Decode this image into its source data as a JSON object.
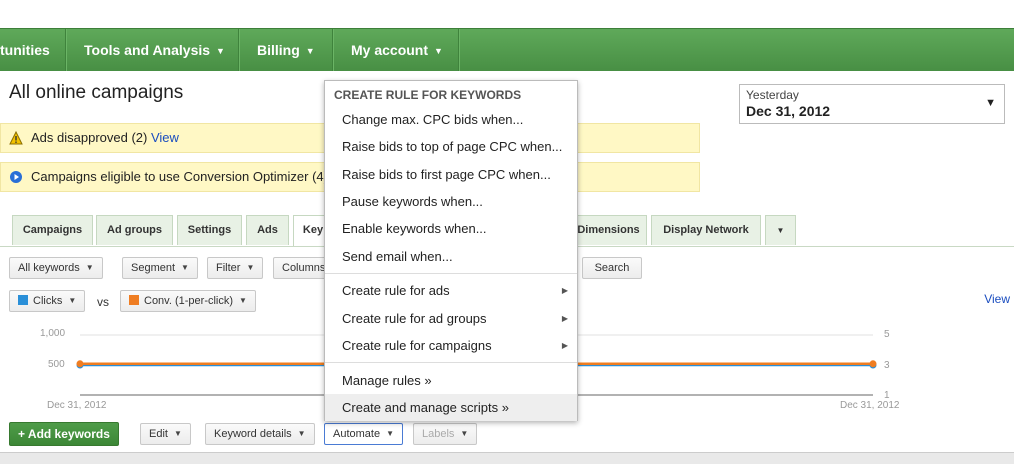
{
  "nav": {
    "items": [
      {
        "label": "tunities",
        "caret": ""
      },
      {
        "label": "Tools and Analysis",
        "caret": "▼"
      },
      {
        "label": "Billing",
        "caret": "▼"
      },
      {
        "label": "My account",
        "caret": "▼"
      }
    ]
  },
  "page": {
    "title": "All online campaigns"
  },
  "date_range": {
    "label": "Yesterday",
    "value": "Dec 31, 2012"
  },
  "alerts": [
    {
      "text": "Ads disapproved (2)",
      "link": "View",
      "icon": "warning-icon"
    },
    {
      "text": "Campaigns eligible to use Conversion Optimizer (4)",
      "icon": "info-icon"
    }
  ],
  "tabs": [
    "Campaigns",
    "Ad groups",
    "Settings",
    "Ads",
    "Key",
    "Dimensions",
    "Display Network"
  ],
  "filters": {
    "all_keywords": "All keywords",
    "segment": "Segment",
    "filter": "Filter",
    "columns": "Columns",
    "search": "Search"
  },
  "metrics": {
    "metric1": "Clicks",
    "vs": "vs",
    "metric2": "Conv. (1-per-click)",
    "view": "View",
    "colors": {
      "metric1": "#2a8fd8",
      "metric2": "#ef7d22"
    }
  },
  "chart_data": {
    "type": "line",
    "x": [
      "Dec 31, 2012",
      "Dec 31, 2012"
    ],
    "y_left_ticks": [
      "1,000",
      "500"
    ],
    "y_right_ticks": [
      "5",
      "3",
      "1"
    ],
    "ylim_left": [
      0,
      1000
    ],
    "ylim_right": [
      0,
      5
    ],
    "series": [
      {
        "name": "Clicks",
        "axis": "left",
        "values": [
          500,
          500
        ]
      },
      {
        "name": "Conv. (1-per-click)",
        "axis": "right",
        "values": [
          2.6,
          2.6
        ]
      }
    ]
  },
  "toolbar": {
    "add_keywords": "+ Add keywords",
    "edit": "Edit",
    "keyword_details": "Keyword details",
    "automate": "Automate",
    "labels": "Labels"
  },
  "automate_menu": {
    "header": "CREATE RULE FOR KEYWORDS",
    "group1": [
      "Change max. CPC bids when...",
      "Raise bids to top of page CPC when...",
      "Raise bids to first page CPC when...",
      "Pause keywords when...",
      "Enable keywords when...",
      "Send email when..."
    ],
    "group2": [
      "Create rule for ads",
      "Create rule for ad groups",
      "Create rule for campaigns"
    ],
    "group3": [
      "Manage rules »",
      "Create and manage scripts »"
    ]
  }
}
